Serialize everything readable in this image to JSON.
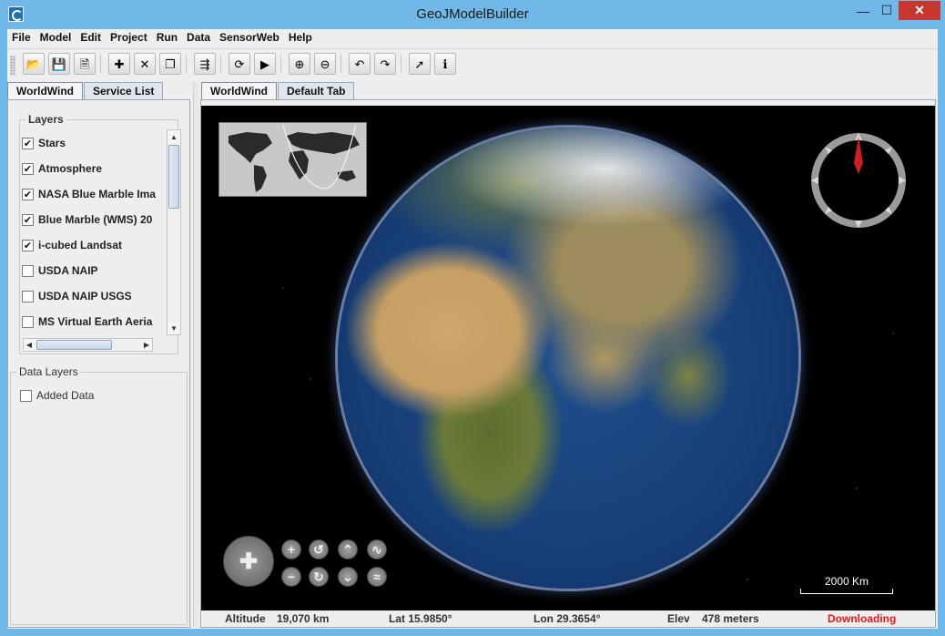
{
  "window": {
    "title": "GeoJModelBuilder",
    "minimize": "—",
    "maximize": "☐",
    "close": "✕"
  },
  "menu": [
    "File",
    "Model",
    "Edit",
    "Project",
    "Run",
    "Data",
    "SensorWeb",
    "Help"
  ],
  "toolbar": {
    "buttons": [
      {
        "name": "open-icon",
        "glyph": "📂"
      },
      {
        "name": "save-icon",
        "glyph": "💾"
      },
      {
        "name": "new-document-icon",
        "glyph": "🗎"
      },
      {
        "name": "add-icon",
        "glyph": "✚"
      },
      {
        "name": "delete-icon",
        "glyph": "✕"
      },
      {
        "name": "copy-icon",
        "glyph": "❐"
      },
      {
        "name": "layout-icon",
        "glyph": "⇶"
      },
      {
        "name": "refresh-icon",
        "glyph": "⟳"
      },
      {
        "name": "run-icon",
        "glyph": "▶"
      },
      {
        "name": "zoom-in-icon",
        "glyph": "⊕"
      },
      {
        "name": "zoom-out-icon",
        "glyph": "⊖"
      },
      {
        "name": "undo-icon",
        "glyph": "↶"
      },
      {
        "name": "redo-icon",
        "glyph": "↷"
      },
      {
        "name": "pointer-icon",
        "glyph": "➚"
      },
      {
        "name": "info-icon",
        "glyph": "ℹ"
      }
    ]
  },
  "left_tabs": [
    {
      "label": "WorldWind",
      "active": true
    },
    {
      "label": "Service List",
      "active": false
    }
  ],
  "layers": {
    "title": "Layers",
    "items": [
      {
        "label": "Stars",
        "checked": true
      },
      {
        "label": "Atmosphere",
        "checked": true
      },
      {
        "label": "NASA Blue Marble Ima",
        "checked": true
      },
      {
        "label": "Blue Marble (WMS) 20",
        "checked": true
      },
      {
        "label": "i-cubed Landsat",
        "checked": true
      },
      {
        "label": "USDA NAIP",
        "checked": false
      },
      {
        "label": "USDA NAIP USGS",
        "checked": false
      },
      {
        "label": "MS Virtual Earth Aeria",
        "checked": false
      }
    ]
  },
  "data_layers": {
    "title": "Data Layers",
    "items": [
      {
        "label": "Added Data",
        "checked": false
      }
    ]
  },
  "right_tabs": [
    {
      "label": "WorldWind",
      "active": true
    },
    {
      "label": "Default Tab",
      "active": false
    }
  ],
  "map": {
    "scale_label": "2000 Km",
    "compass_needle_color": "#cc1f1f"
  },
  "status": {
    "altitude_label": "Altitude",
    "altitude_value": "19,070 km",
    "lat": "Lat 15.9850°",
    "lon": "Lon 29.3654°",
    "elev_label": "Elev",
    "elev_value": "478 meters",
    "downloading": "Downloading"
  }
}
